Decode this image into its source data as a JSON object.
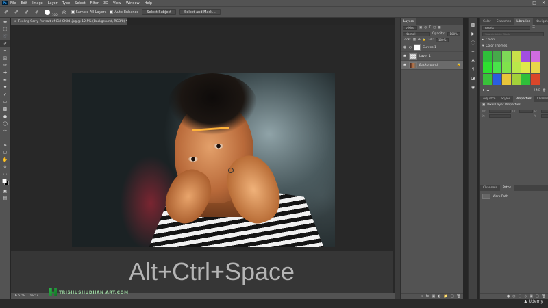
{
  "menubar": {
    "logo": "Ps",
    "items": [
      "File",
      "Edit",
      "Image",
      "Layer",
      "Type",
      "Select",
      "Filter",
      "3D",
      "View",
      "Window",
      "Help"
    ]
  },
  "options": {
    "brush_size": "100",
    "sample_all_layers": "Sample All Layers",
    "auto_enhance": "Auto-Enhance",
    "select_subject": "Select Subject",
    "select_and_mask": "Select and Mask..."
  },
  "document": {
    "tab_title": "Feeling Sorry-Portrait of Girl Child .jpg @ 12.5% (Background, RGB/8) *",
    "zoom": "16.67%",
    "doc_info": "Doc: 4"
  },
  "overlay": {
    "shortcut": "Alt+Ctrl+Space",
    "watermark": "TRISHUSHUDHAN ART.COM"
  },
  "layers_panel": {
    "tabs": [
      "Layers"
    ],
    "filter_label": "Kind",
    "blend_mode": "Normal",
    "opacity_label": "Opacity:",
    "opacity": "100%",
    "lock_label": "Lock:",
    "fill_label": "Fill:",
    "fill": "100%",
    "layers": [
      {
        "name": "Curves 1",
        "kind": "adjust"
      },
      {
        "name": "Layer 1",
        "kind": "check"
      },
      {
        "name": "Background",
        "kind": "photo"
      }
    ]
  },
  "right_panel": {
    "top_tabs": [
      "Color",
      "Swatches",
      "Libraries",
      "Navigator"
    ],
    "active_tab": "Libraries",
    "library": "Assets",
    "search_placeholder": "Search Adobe Stock",
    "colors_label": "Colors",
    "themes_label": "Color Themes",
    "theme_colors": [
      "#2fbf3a",
      "#46a84a",
      "#7ed957",
      "#c8e04a",
      "#a24ee0",
      "#d06ce0",
      "#2de02f",
      "#49e34a",
      "#7fe24c",
      "#b9e84a",
      "#dfe84a",
      "#e8d64a",
      "#39c23a",
      "#2a5ee0",
      "#e8c53a",
      "#a3d13a",
      "#2fbf3a",
      "#d9462a"
    ],
    "storage": "2 MB",
    "prop_tabs": [
      "Adjustm",
      "Styles",
      "Properties",
      "Channels"
    ],
    "active_prop_tab": "Properties",
    "prop_title": "Pixel Layer Properties",
    "prop_labels": [
      "W:",
      "GO",
      "H:",
      "X:",
      "Y:"
    ],
    "paths_tabs": [
      "Channels",
      "Paths"
    ],
    "active_paths_tab": "Paths",
    "path_name": "Work Path"
  },
  "brand": {
    "udemy": "Udemy"
  }
}
